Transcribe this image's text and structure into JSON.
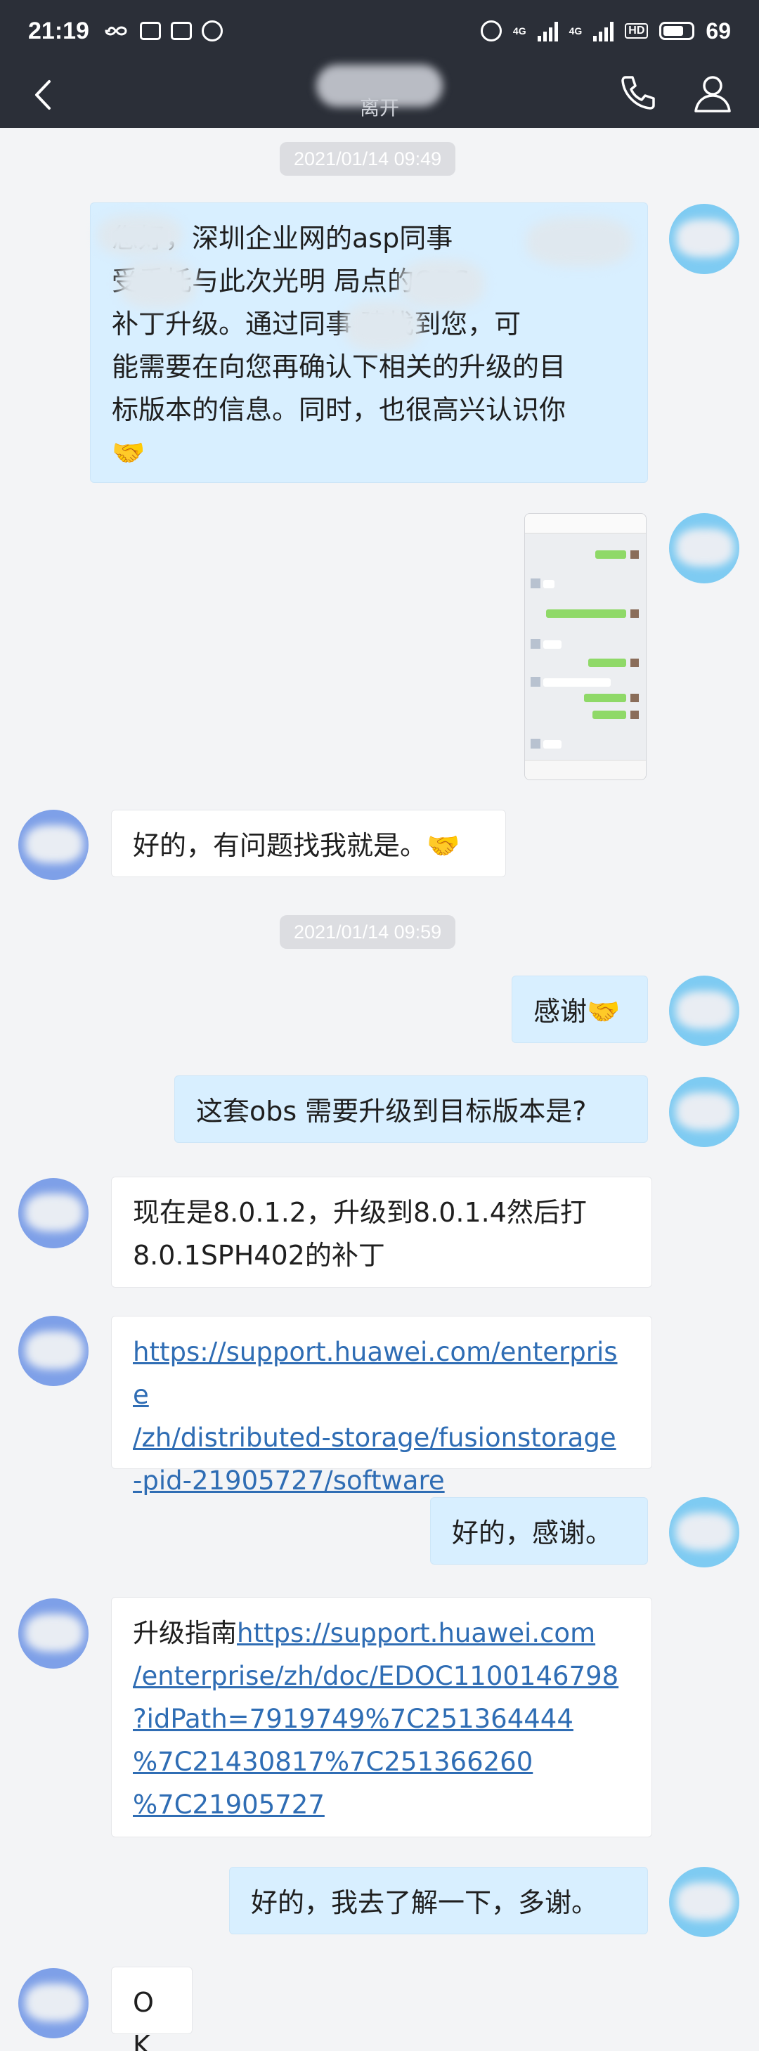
{
  "status_bar": {
    "time": "21:19",
    "network_4g_a": "4G",
    "network_4g_b": "4G",
    "hd_badge": "HD",
    "battery": "69"
  },
  "header": {
    "subtitle": "离开"
  },
  "timestamps": [
    "2021/01/14 09:49",
    "2021/01/14 09:59"
  ],
  "messages": {
    "m1": {
      "line1": "  您好，深圳企业网的asp同事",
      "line2": "       受委托与此次光明      局点的OBS",
      "line3": "补丁升级。通过同事      建找到您，可",
      "line4": "能需要在向您再确认下相关的升级的目",
      "line5": "标版本的信息。同时，也很高兴认识你"
    },
    "m3": {
      "text": "好的，有问题找我就是。"
    },
    "m4": {
      "text": "感谢"
    },
    "m5": {
      "text": "这套obs 需要升级到目标版本是?"
    },
    "m6": {
      "line1": "现在是8.0.1.2，升级到8.0.1.4然后打",
      "line2": "8.0.1SPH402的补丁"
    },
    "m7": {
      "line1": "https://support.huawei.com/enterprise",
      "line2": "/zh/distributed-storage/fusionstorage",
      "line3": "-pid-21905727/software"
    },
    "m8": {
      "text": "好的，感谢。"
    },
    "m9": {
      "prefix": "升级指南",
      "line1": "https://support.huawei.com",
      "line2": "/enterprise/zh/doc/EDOC1100146798",
      "line3": "?idPath=7919749%7C251364444",
      "line4": "%7C21430817%7C251366260",
      "line5": "%7C21905727"
    },
    "m10": {
      "text": "好的，我去了解一下，多谢。"
    },
    "m11": {
      "text": "OK"
    }
  },
  "colors": {
    "header_bg": "#2b2f38",
    "chat_bg": "#f3f4f6",
    "outgoing_bubble": "#d8efff",
    "incoming_bubble": "#ffffff",
    "link": "#2f6db4"
  },
  "icons": {
    "back": "chevron-left-icon",
    "call": "phone-icon",
    "profile": "user-icon",
    "handshake": "handshake-emoji"
  }
}
